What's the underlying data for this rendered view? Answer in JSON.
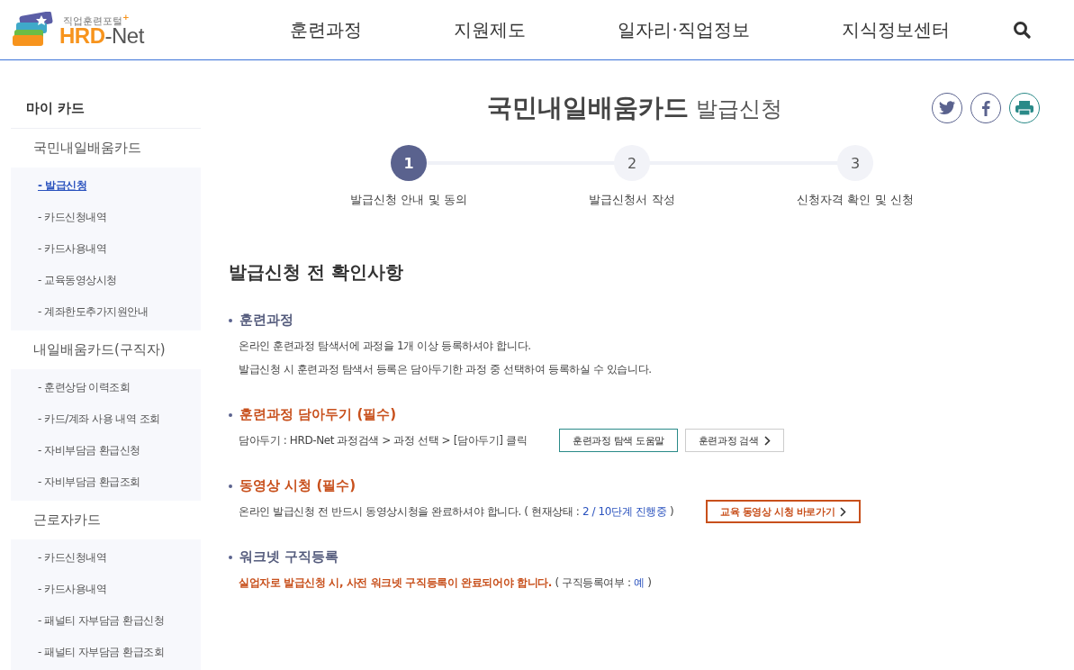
{
  "header": {
    "logo": {
      "tagline": "직업훈련포털$^{+}$",
      "brand": "**HRD**-Net"
    },
    "nav": [
      {
        "label": "훈련과정"
      },
      {
        "label": "지원제도"
      },
      {
        "label": "일자리·직업정보"
      },
      {
        "label": "지식정보센터"
      }
    ]
  },
  "sidebar": {
    "title": "마이 카드",
    "groups": [
      {
        "label": "국민내일배움카드",
        "items": [
          {
            "label": "- 발급신청",
            "selected": true
          },
          {
            "label": "- 카드신청내역",
            "selected": false
          },
          {
            "label": "- 카드사용내역",
            "selected": false
          },
          {
            "label": "- 교육동영상시청",
            "selected": false
          },
          {
            "label": "- 계좌한도추가지원안내",
            "selected": false
          }
        ]
      },
      {
        "label": "내일배움카드(구직자)",
        "items": [
          {
            "label": "- 훈련상담 이력조회",
            "selected": false
          },
          {
            "label": "- 카드/계좌 사용 내역 조회",
            "selected": false
          },
          {
            "label": "- 자비부담금 환급신청",
            "selected": false
          },
          {
            "label": "- 자비부담금 환급조회",
            "selected": false
          }
        ]
      },
      {
        "label": "근로자카드",
        "items": [
          {
            "label": "- 카드신청내역",
            "selected": false
          },
          {
            "label": "- 카드사용내역",
            "selected": false
          },
          {
            "label": "- 패널티 자부담금 환급신청",
            "selected": false
          },
          {
            "label": "- 패널티 자부담금 환급조회",
            "selected": false
          }
        ]
      }
    ]
  },
  "page": {
    "title": "국민내일배움카드",
    "subtitle": "발급신청",
    "steps": [
      {
        "number": "1",
        "label": "발급신청 안내 및 동의",
        "selected": true
      },
      {
        "number": "2",
        "label": "발급신청서 작성",
        "selected": false
      },
      {
        "number": "3",
        "label": "신청자격 확인 및 신청",
        "selected": false
      }
    ],
    "section_title": "발급신청 전 확인사항",
    "items": [
      {
        "title": "훈련과정",
        "required": false,
        "lines": [
          [
            {
              "kind": "normal",
              "text": "온라인 훈련과정 탐색서에 과정을 1개 이상 등록하셔야 합니다."
            }
          ],
          [
            {
              "kind": "normal",
              "text": "발급신청 시 훈련과정 탐색서 등록은 담아두기한 과정 중 선택하여 등록하실 수 있습니다."
            }
          ]
        ]
      },
      {
        "title": "훈련과정 담아두기 (필수)",
        "required": true,
        "lines": [
          [
            {
              "kind": "normal",
              "text": "담아두기 : HRD-Net 과정검색 > 과정 선택 > [담아두기] 클릭"
            }
          ]
        ],
        "buttons": [
          {
            "kind": "teal",
            "label": "훈련과정 탐색 도움말",
            "arrow": false
          },
          {
            "kind": "plain",
            "label": "훈련과정 검색",
            "arrow": true
          }
        ]
      },
      {
        "title": "동영상 시청 (필수)",
        "required": true,
        "lines": [
          [
            {
              "kind": "normal",
              "text": "온라인 발급신청 전 반드시 동영상시청을 완료하셔야 합니다. ( 현재상태 :"
            },
            {
              "kind": "info",
              "text": "2 / 10단계 진행중"
            },
            {
              "kind": "normal",
              "text": ")"
            }
          ]
        ],
        "buttons": [
          {
            "kind": "warn",
            "label": "교육 동영상 시청 바로가기",
            "arrow": true
          }
        ]
      },
      {
        "title": "워크넷 구직등록",
        "required": false,
        "lines": [
          [
            {
              "kind": "alert",
              "text": "실업자로 발급신청 시, 사전 워크넷 구직등록이 완료되어야 합니다."
            },
            {
              "kind": "normal",
              "text": "( 구직등록여부 :"
            },
            {
              "kind": "info",
              "text": "예"
            },
            {
              "kind": "normal",
              "text": ")"
            }
          ]
        ]
      }
    ]
  }
}
